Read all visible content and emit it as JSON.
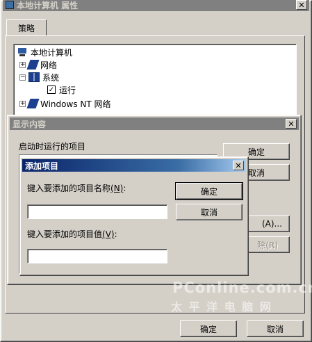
{
  "main_window": {
    "title": "本地计算机 属性",
    "close_glyph": "✕",
    "tab_policy": "策略",
    "ok_label": "确定",
    "cancel_label": "取消"
  },
  "tree": {
    "items": [
      {
        "label": "本地计算机"
      },
      {
        "label": "网络",
        "expander": "+"
      },
      {
        "label": "系统",
        "expander": "−"
      },
      {
        "label": "运行",
        "checked": "✓"
      },
      {
        "label": "Windows NT 网络",
        "expander": "+"
      }
    ]
  },
  "show_contents": {
    "title": "显示内容",
    "close_glyph": "✕",
    "list_label": "启动时运行的项目",
    "ok_label": "确定",
    "cancel_label": "取消",
    "add_label_tail": "(A)...",
    "remove_label_tail": "除(R)"
  },
  "add_item": {
    "title": "添加项目",
    "close_glyph": "✕",
    "name_prompt": "键入要添加的项目名称",
    "name_hotkey": "(N)",
    "name_colon": ":",
    "name_value": "",
    "value_prompt": "键入要添加的项目值",
    "value_hotkey": "(V)",
    "value_colon": ":",
    "value_value": "",
    "ok_label": "确定",
    "cancel_label": "取消"
  },
  "watermark": {
    "line1": "PConline.com.cn",
    "line2": "太 平 洋 电 脑 网"
  },
  "colors": {
    "active_title_start": "#0a246a",
    "active_title_end": "#a6caf0",
    "inactive_title": "#808080",
    "face": "#d4d0c8"
  }
}
